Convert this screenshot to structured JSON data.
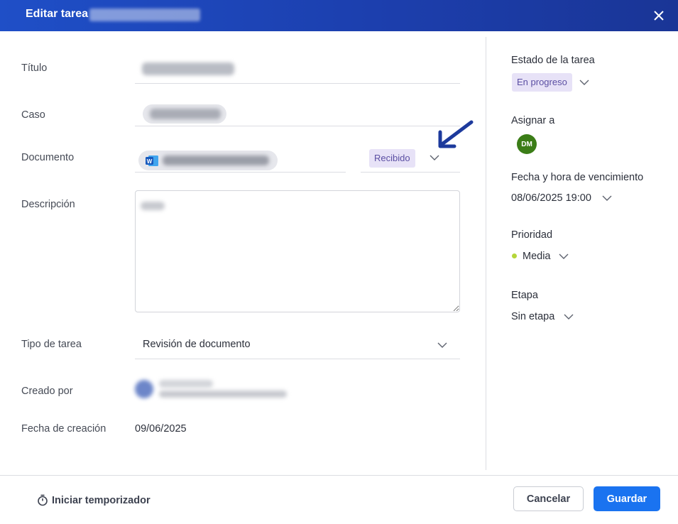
{
  "dialog": {
    "title": "Editar tarea"
  },
  "form": {
    "titulo_label": "Título",
    "caso_label": "Caso",
    "documento_label": "Documento",
    "documento_status": "Recibido",
    "descripcion_label": "Descripción",
    "tipo_label": "Tipo de tarea",
    "tipo_value": "Revisión de documento",
    "creado_label": "Creado por",
    "fecha_label": "Fecha de creación",
    "fecha_value": "09/06/2025"
  },
  "side": {
    "estado_label": "Estado de la tarea",
    "estado_value": "En progreso",
    "asignar_label": "Asignar a",
    "asignar_initials": "DM",
    "vencimiento_label": "Fecha y hora de vencimiento",
    "vencimiento_value": "08/06/2025 19:00",
    "prioridad_label": "Prioridad",
    "prioridad_value": "Media",
    "etapa_label": "Etapa",
    "etapa_value": "Sin etapa"
  },
  "footer": {
    "timer_label": "Iniciar temporizador",
    "cancel_label": "Cancelar",
    "save_label": "Guardar"
  },
  "colors": {
    "header": "#1f4fc7",
    "primary_button": "#1a73f0",
    "badge_bg": "#e7e2f7",
    "avatar": "#3b7d17",
    "priority_dot": "#b5d63a",
    "arrow": "#1d3a9c"
  },
  "icons": [
    "close-icon",
    "chevron-down-icon",
    "word-file-icon",
    "timer-icon",
    "arrow-annotation-icon"
  ]
}
